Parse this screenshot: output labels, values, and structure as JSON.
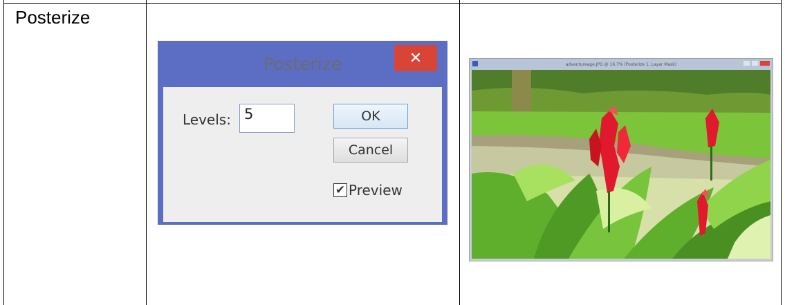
{
  "table": {
    "row_label": "Posterize"
  },
  "dialog": {
    "title": "Posterize",
    "close_glyph": "✕",
    "levels_label": "Levels:",
    "levels_value": "5",
    "ok_label": "OK",
    "cancel_label": "Cancel",
    "preview_label": "Preview",
    "preview_checked": true,
    "checkmark_glyph": "✔"
  },
  "photo_window": {
    "title": "adventureage.JPG @ 16.7% (Posterize 1, Layer Mask)"
  },
  "colors": {
    "title_bar": "#5b6ec4",
    "close_button": "#d94437",
    "dialog_body": "#eeeeee",
    "flower_red": "#e01a2c",
    "leaf_green": "#5fae2c"
  }
}
